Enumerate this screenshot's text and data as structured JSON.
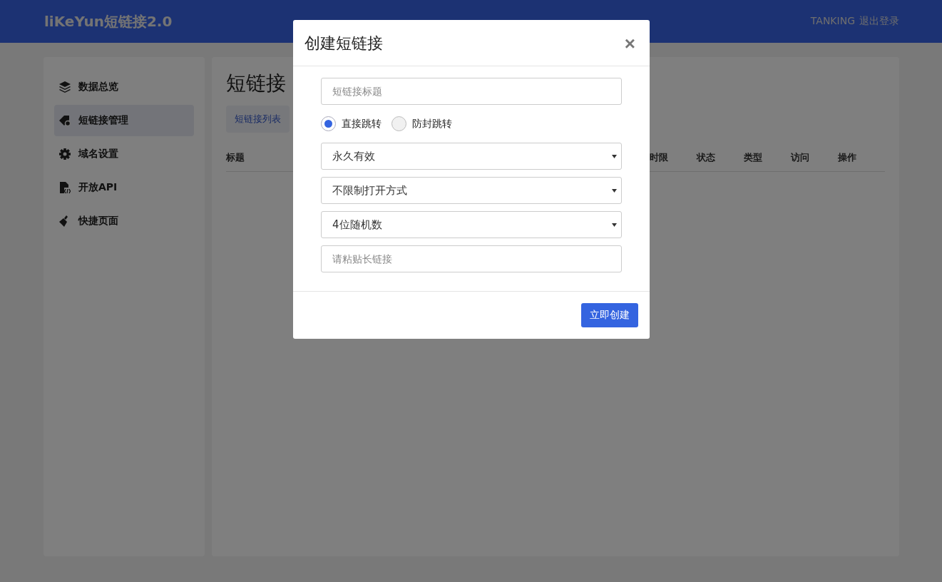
{
  "header": {
    "logo": "liKeYun短链接2.0",
    "user": "TANKING",
    "logout": "退出登录"
  },
  "sidebar": {
    "items": [
      {
        "label": "数据总览",
        "kind": "overview",
        "selected": false
      },
      {
        "label": "短链接管理",
        "kind": "links",
        "selected": true
      },
      {
        "label": "域名设置",
        "kind": "settings",
        "selected": false
      },
      {
        "label": "开放API",
        "kind": "api",
        "selected": false
      },
      {
        "label": "快捷页面",
        "kind": "pages",
        "selected": false
      }
    ]
  },
  "main": {
    "title": "短链接",
    "tabs": [
      {
        "label": "短链接列表",
        "selected": true
      }
    ],
    "table": {
      "columns": [
        "标题",
        "时限",
        "状态",
        "类型",
        "访问",
        "操作"
      ]
    }
  },
  "modal": {
    "title": "创建短链接",
    "close": "×",
    "fields": [
      {
        "kind": "text",
        "placeholder": "短链接标题"
      },
      {
        "kind": "radios",
        "options": [
          {
            "label": "直接跳转",
            "selected": true
          },
          {
            "label": "防封跳转",
            "selected": false
          }
        ]
      },
      {
        "kind": "select",
        "value": "永久有效"
      },
      {
        "kind": "select",
        "value": "不限制打开方式"
      },
      {
        "kind": "select",
        "value": "4位随机数"
      },
      {
        "kind": "text",
        "placeholder": "请粘贴长链接"
      }
    ],
    "submit": "立即创建"
  }
}
